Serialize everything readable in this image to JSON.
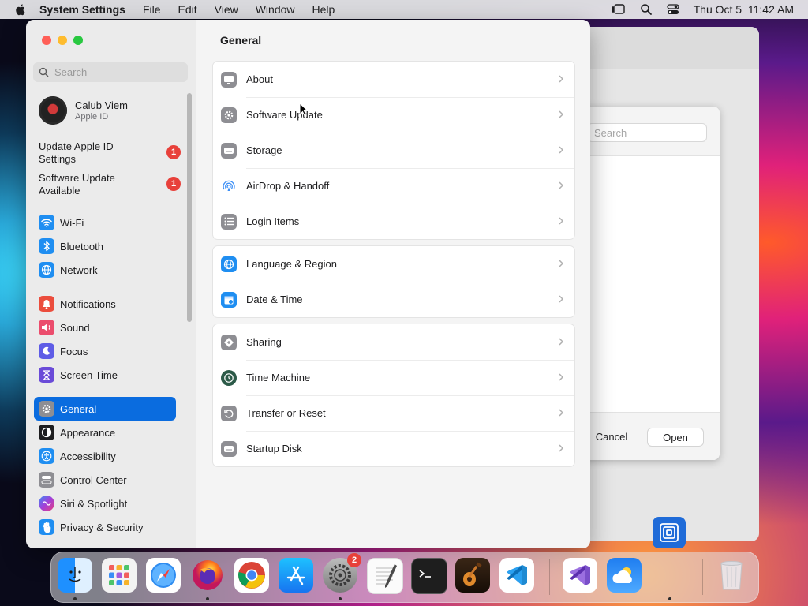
{
  "menubar": {
    "app_name": "System Settings",
    "menus": [
      "File",
      "Edit",
      "View",
      "Window",
      "Help"
    ],
    "datetime": "Thu Oct 5  11:42 AM"
  },
  "background_dialog": {
    "search_placeholder": "Search",
    "cancel_label": "Cancel",
    "open_label": "Open"
  },
  "window": {
    "sidebar": {
      "search_placeholder": "Search",
      "profile": {
        "name": "Calub Viem",
        "subtitle": "Apple ID"
      },
      "notices": [
        {
          "label": "Update Apple ID Settings",
          "badge": "1"
        },
        {
          "label": "Software Update Available",
          "badge": "1"
        }
      ],
      "items": [
        {
          "label": "Wi-Fi",
          "icon": "wifi-icon",
          "color": "#1f8ef1"
        },
        {
          "label": "Bluetooth",
          "icon": "bluetooth-icon",
          "color": "#1f8ef1"
        },
        {
          "label": "Network",
          "icon": "globe-icon",
          "color": "#1f8ef1"
        },
        {
          "label": "Notifications",
          "icon": "bell-icon",
          "color": "#eb4d3d"
        },
        {
          "label": "Sound",
          "icon": "speaker-icon",
          "color": "#eb4d6d"
        },
        {
          "label": "Focus",
          "icon": "moon-icon",
          "color": "#5e5ce6"
        },
        {
          "label": "Screen Time",
          "icon": "hourglass-icon",
          "color": "#6a4bd8"
        },
        {
          "label": "General",
          "icon": "gear-icon",
          "color": "#8e8e93",
          "selected": true
        },
        {
          "label": "Appearance",
          "icon": "appearance-icon",
          "color": "#1d1d1f"
        },
        {
          "label": "Accessibility",
          "icon": "accessibility-icon",
          "color": "#1f8ef1"
        },
        {
          "label": "Control Center",
          "icon": "toggles-icon",
          "color": "#8e8e93"
        },
        {
          "label": "Siri & Spotlight",
          "icon": "siri-icon",
          "color": "#7a4be0"
        },
        {
          "label": "Privacy & Security",
          "icon": "hand-icon",
          "color": "#1f8ef1"
        }
      ]
    },
    "main": {
      "title": "General",
      "groups": [
        [
          {
            "label": "About",
            "icon": "display-icon"
          },
          {
            "label": "Software Update",
            "icon": "gear-badge-icon"
          },
          {
            "label": "Storage",
            "icon": "drive-icon"
          },
          {
            "label": "AirDrop & Handoff",
            "icon": "airdrop-icon"
          },
          {
            "label": "Login Items",
            "icon": "list-icon"
          }
        ],
        [
          {
            "label": "Language & Region",
            "icon": "globe-icon"
          },
          {
            "label": "Date & Time",
            "icon": "calendar-clock-icon"
          }
        ],
        [
          {
            "label": "Sharing",
            "icon": "sharing-icon"
          },
          {
            "label": "Time Machine",
            "icon": "time-machine-icon"
          },
          {
            "label": "Transfer or Reset",
            "icon": "reset-icon"
          },
          {
            "label": "Startup Disk",
            "icon": "disk-icon"
          }
        ]
      ]
    }
  },
  "dock": {
    "apps": [
      "Finder",
      "Launchpad",
      "Safari",
      "Firefox",
      "Chrome",
      "App Store",
      "System Settings",
      "TextEdit",
      "Terminal",
      "GarageBand",
      "Visual Studio Code",
      "Visual Studio",
      "Weather",
      "Trash"
    ],
    "system_settings_badge": "2"
  }
}
